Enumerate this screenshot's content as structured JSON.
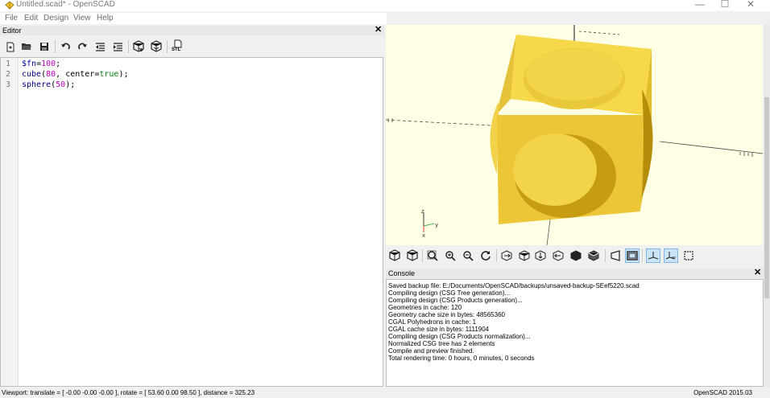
{
  "window": {
    "title": "Untitled.scad* - OpenSCAD",
    "minimize": "—",
    "maximize": "☐",
    "close": "✕"
  },
  "menu": {
    "items": [
      "File",
      "Edit",
      "Design",
      "View",
      "Help"
    ]
  },
  "editor": {
    "title": "Editor",
    "close": "✕",
    "toolbar_stl_label": "STL",
    "lines": [
      {
        "no": "1"
      },
      {
        "no": "2"
      },
      {
        "no": "3"
      }
    ],
    "code": {
      "l1_var": "$fn",
      "l1_eq": "=",
      "l1_num": "100",
      "l1_end": ";",
      "l2_mod": "cube",
      "l2_open": "(",
      "l2_num": "80",
      "l2_sep": ", center=",
      "l2_kw": "true",
      "l2_end": ");",
      "l3_mod": "sphere",
      "l3_open": "(",
      "l3_num": "50",
      "l3_end": ");"
    }
  },
  "viewport": {
    "axis_labels": {
      "z": "z",
      "x": "x",
      "y": "y"
    },
    "colors": {
      "background": "#ffffe5",
      "model": "#f7d84a",
      "model_dark": "#d4ac0d",
      "axis": "#000000"
    }
  },
  "console": {
    "title": "Console",
    "close": "✕",
    "lines": [
      "Saved backup file: E:/Documents/OpenSCAD/backups/unsaved-backup-SEef5220.scad",
      "Compiling design (CSG Tree generation)...",
      "Compiling design (CSG Products generation)...",
      "Geometries in cache: 120",
      "Geometry cache size in bytes: 48565360",
      "CGAL Polyhedrons in cache: 1",
      "CGAL cache size in bytes: 1111904",
      "Compiling design (CSG Products normalization)...",
      "Normalized CSG tree has 2 elements",
      "Compile and preview finished.",
      "Total rendering time: 0 hours, 0 minutes, 0 seconds"
    ]
  },
  "statusbar": {
    "viewport_info": "Viewport: translate = [ -0.00 -0.00 -0.00 ], rotate = [ 53.60 0.00 98.50 ], distance = 325.23",
    "version": "OpenSCAD 2015.03"
  }
}
